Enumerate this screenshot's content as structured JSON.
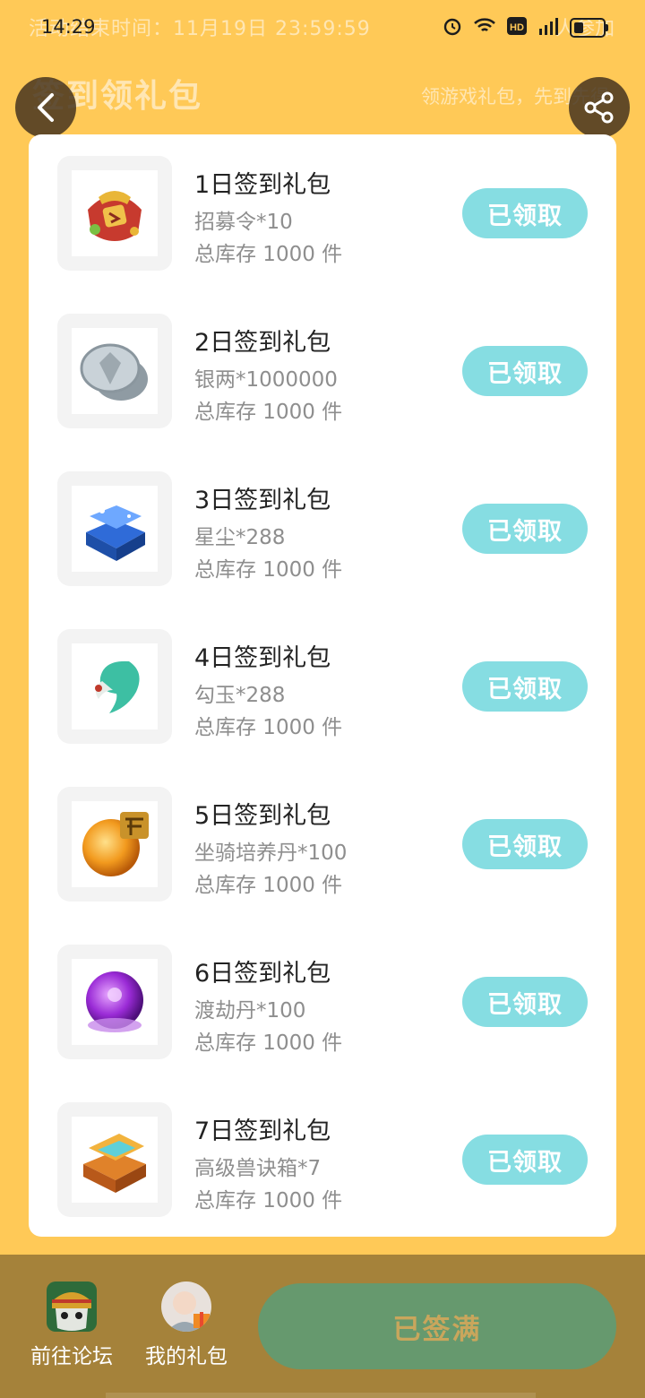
{
  "status": {
    "time": "14:29",
    "ghost_text": "活动结束时间：11月19日 23:59:59",
    "ghost_right": "人参加"
  },
  "header": {
    "title": "签到领礼包",
    "subtitle": "领游戏礼包，先到先得"
  },
  "items": [
    {
      "title": "1日签到礼包",
      "reward": "招募令*10",
      "stock": "总库存 1000 件",
      "button": "已领取",
      "icon": "recruit-token-icon"
    },
    {
      "title": "2日签到礼包",
      "reward": "银两*1000000",
      "stock": "总库存 1000 件",
      "button": "已领取",
      "icon": "silver-coin-icon"
    },
    {
      "title": "3日签到礼包",
      "reward": "星尘*288",
      "stock": "总库存 1000 件",
      "button": "已领取",
      "icon": "stardust-chest-icon"
    },
    {
      "title": "4日签到礼包",
      "reward": "勾玉*288",
      "stock": "总库存 1000 件",
      "button": "已领取",
      "icon": "magatama-icon"
    },
    {
      "title": "5日签到礼包",
      "reward": "坐骑培养丹*100",
      "stock": "总库存 1000 件",
      "button": "已领取",
      "icon": "mount-pill-icon"
    },
    {
      "title": "6日签到礼包",
      "reward": "渡劫丹*100",
      "stock": "总库存 1000 件",
      "button": "已领取",
      "icon": "tribulation-pill-icon"
    },
    {
      "title": "7日签到礼包",
      "reward": "高级兽诀箱*7",
      "stock": "总库存 1000 件",
      "button": "已领取",
      "icon": "beast-chest-icon"
    }
  ],
  "bottom": {
    "forum_label": "前往论坛",
    "gifts_label": "我的礼包",
    "signed_label": "已签满"
  },
  "colors": {
    "background": "#FFC957",
    "claimed_button": "#86DDE2",
    "bottom_bar": "#A5823A",
    "signed_button": "#66996E"
  }
}
